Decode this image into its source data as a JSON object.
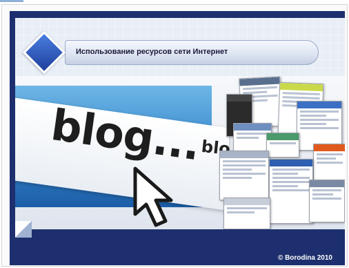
{
  "slide": {
    "title": "Использование ресурсов сети Интернет",
    "image_text_large": "blog...",
    "image_text_small": "blo",
    "copyright": "© Borodina 2010"
  },
  "colors": {
    "navy": "#1d2f6e",
    "accent_blue": "#3e8dd0",
    "diamond_blue": "#2f5fc4"
  },
  "icons": {
    "cursor": "mouse-pointer-icon",
    "diamond": "diamond-bullet-icon"
  }
}
